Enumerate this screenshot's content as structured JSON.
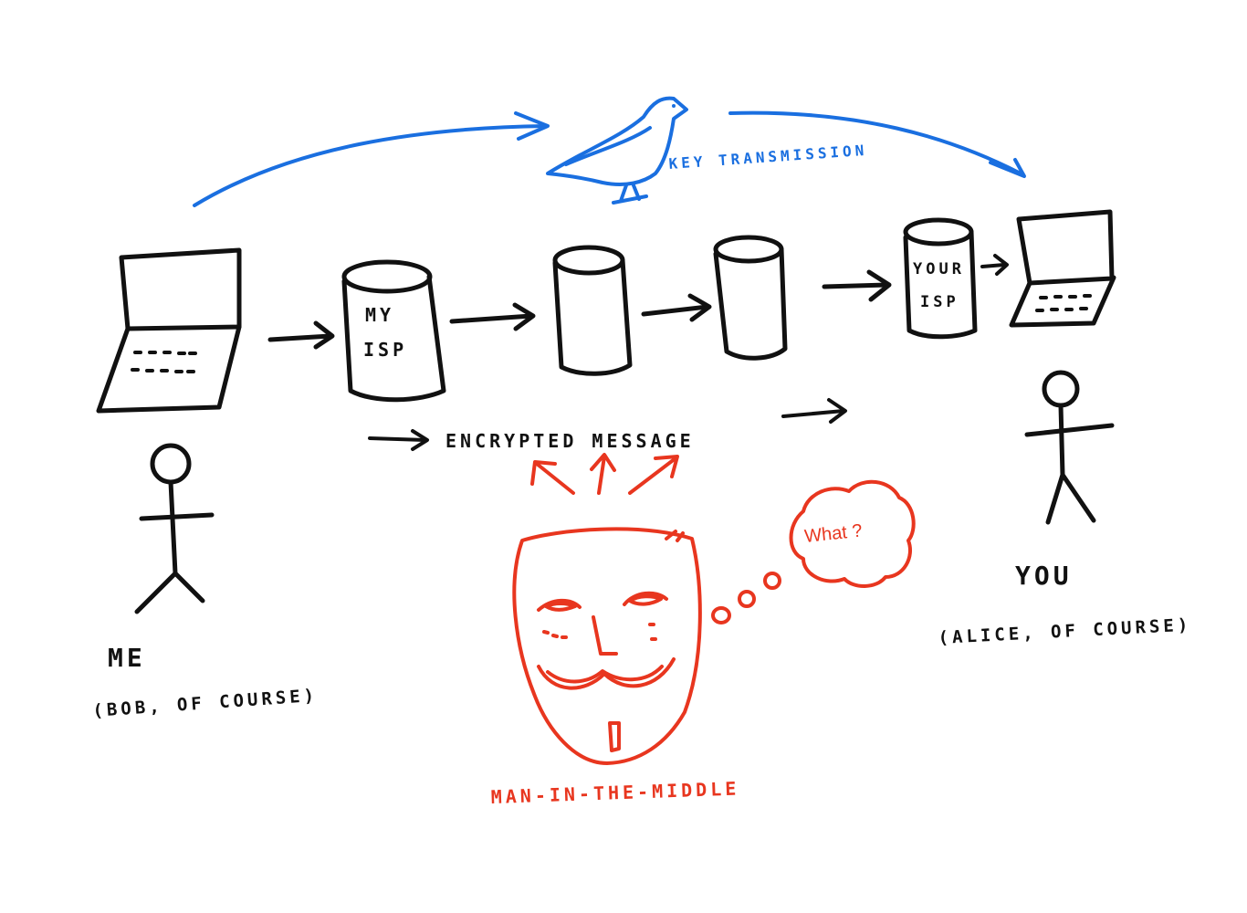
{
  "colors": {
    "ink": "#111111",
    "key_path": "#1a6fe0",
    "attacker": "#e8361f"
  },
  "labels": {
    "key_transmission": "KEY TRANSMISSION",
    "my_isp_line1": "MY",
    "my_isp_line2": "ISP",
    "your_isp_line1": "YOUR",
    "your_isp_line2": "ISP",
    "encrypted_message": "ENCRYPTED MESSAGE",
    "sender_name": "ME",
    "sender_detail": "(BOB, OF COURSE)",
    "receiver_name": "YOU",
    "receiver_detail": "(ALICE, OF COURSE)",
    "attacker_thought": "What ?",
    "attacker_name": "MAN-IN-THE-MIDDLE"
  },
  "icons": {
    "sender_device": "laptop-icon",
    "receiver_device": "laptop-icon",
    "servers": "server-cylinder-icon",
    "key_carrier": "bird-icon",
    "attacker": "guy-fawkes-mask-icon",
    "people": "stick-figure-icon"
  }
}
